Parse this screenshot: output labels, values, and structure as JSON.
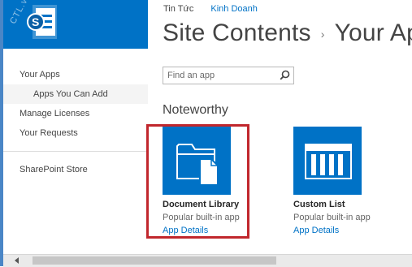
{
  "brand": {
    "color": "#0072c6",
    "watermark": "CTL.vn",
    "icon": "sharepoint-logo-icon"
  },
  "topnav": {
    "home": "Tin Tức",
    "link": "Kinh Doanh"
  },
  "title": {
    "main": "Site Contents",
    "separator": "›",
    "sub": "Your Ap"
  },
  "sidebar": {
    "items": [
      {
        "label": "Your Apps"
      },
      {
        "label": "Apps You Can Add"
      },
      {
        "label": "Manage Licenses"
      },
      {
        "label": "Your Requests"
      },
      {
        "label": "SharePoint Store"
      }
    ]
  },
  "search": {
    "placeholder": "Find an app",
    "icon": "search-icon"
  },
  "section": {
    "heading": "Noteworthy"
  },
  "apps": [
    {
      "name": "Document Library",
      "description": "Popular built-in app",
      "details": "App Details",
      "icon": "document-library-icon",
      "highlighted": true
    },
    {
      "name": "Custom List",
      "description": "Popular built-in app",
      "details": "App Details",
      "icon": "custom-list-icon",
      "highlighted": false
    }
  ],
  "colors": {
    "accent": "#0072c6",
    "highlight": "#c1272d"
  }
}
